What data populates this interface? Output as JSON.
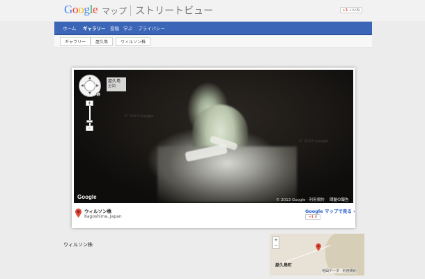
{
  "header": {
    "logo_google": "Google",
    "maps_label": "マップ",
    "title": "ストリートビュー",
    "like_g": "+1",
    "like_label": "いいね"
  },
  "nav": {
    "items": [
      {
        "label": "ホーム",
        "active": false
      },
      {
        "label": "ギャラリー",
        "active": true
      },
      {
        "label": "投稿",
        "active": false
      },
      {
        "label": "学ぶ",
        "active": false
      },
      {
        "label": "プライバシー",
        "active": false
      }
    ]
  },
  "breadcrumb": [
    "ギャラリー",
    "屋久島",
    "ウィルソン株"
  ],
  "viewer": {
    "chip_title": "屋久島",
    "chip_sub": "全図",
    "watermark": "© 2013 Google",
    "google_logo": "Google",
    "copyright": "© 2013 Google · 利用規約",
    "report": "問題の報告",
    "zoom_in": "+",
    "zoom_out": "−",
    "compass": "N"
  },
  "info": {
    "place_name": "ウィルソン株",
    "region": "Kagoshima, Japan",
    "view_link": "Google マップで見る ›",
    "like_g": "+1",
    "like_count": "0"
  },
  "bottom": {
    "title": "ウィルソン株"
  },
  "minimap": {
    "town": "屋久島町",
    "attribution": "地図データ · 利用規約",
    "zoom_in": "+",
    "zoom_out": "−"
  },
  "colors": {
    "nav_bg": "#3b65b7",
    "link": "#1a55c8",
    "pin": "#dd4b39"
  }
}
